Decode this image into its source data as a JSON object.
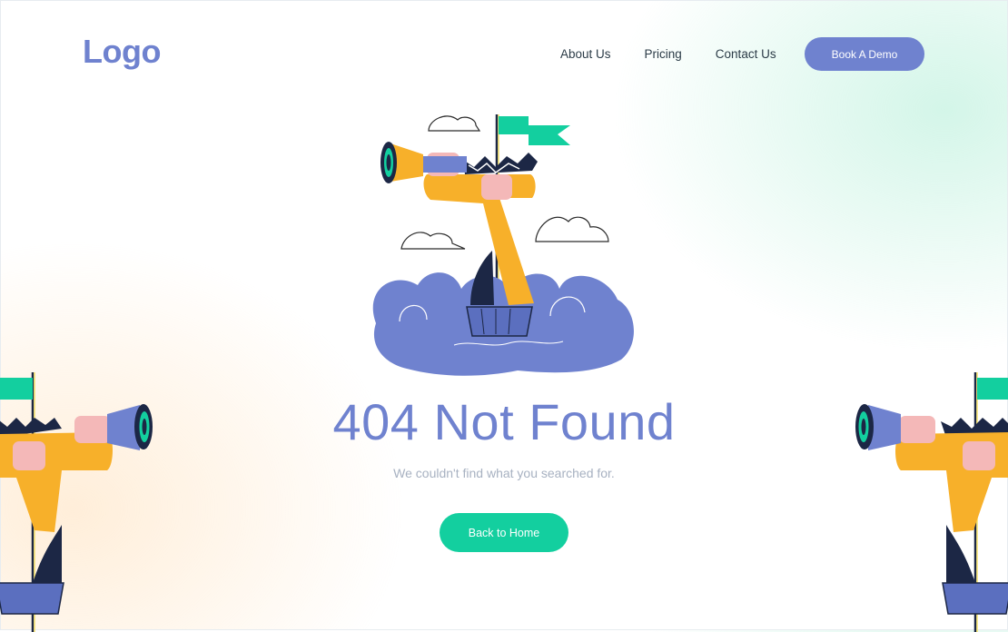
{
  "header": {
    "logo": "Logo",
    "nav": [
      "About Us",
      "Pricing",
      "Contact Us"
    ],
    "cta_label": "Book A Demo"
  },
  "main": {
    "title": "404 Not Found",
    "subtitle": "We couldn't find what you searched for.",
    "home_button_label": "Back to Home"
  },
  "colors": {
    "brand": "#6f82cf",
    "accent": "#13cf9f",
    "illustration_yellow": "#f7b02a",
    "illustration_dark": "#1c2745"
  },
  "icons": [
    "telescope-pirate-illustration",
    "cloud-icon",
    "flag-icon"
  ]
}
